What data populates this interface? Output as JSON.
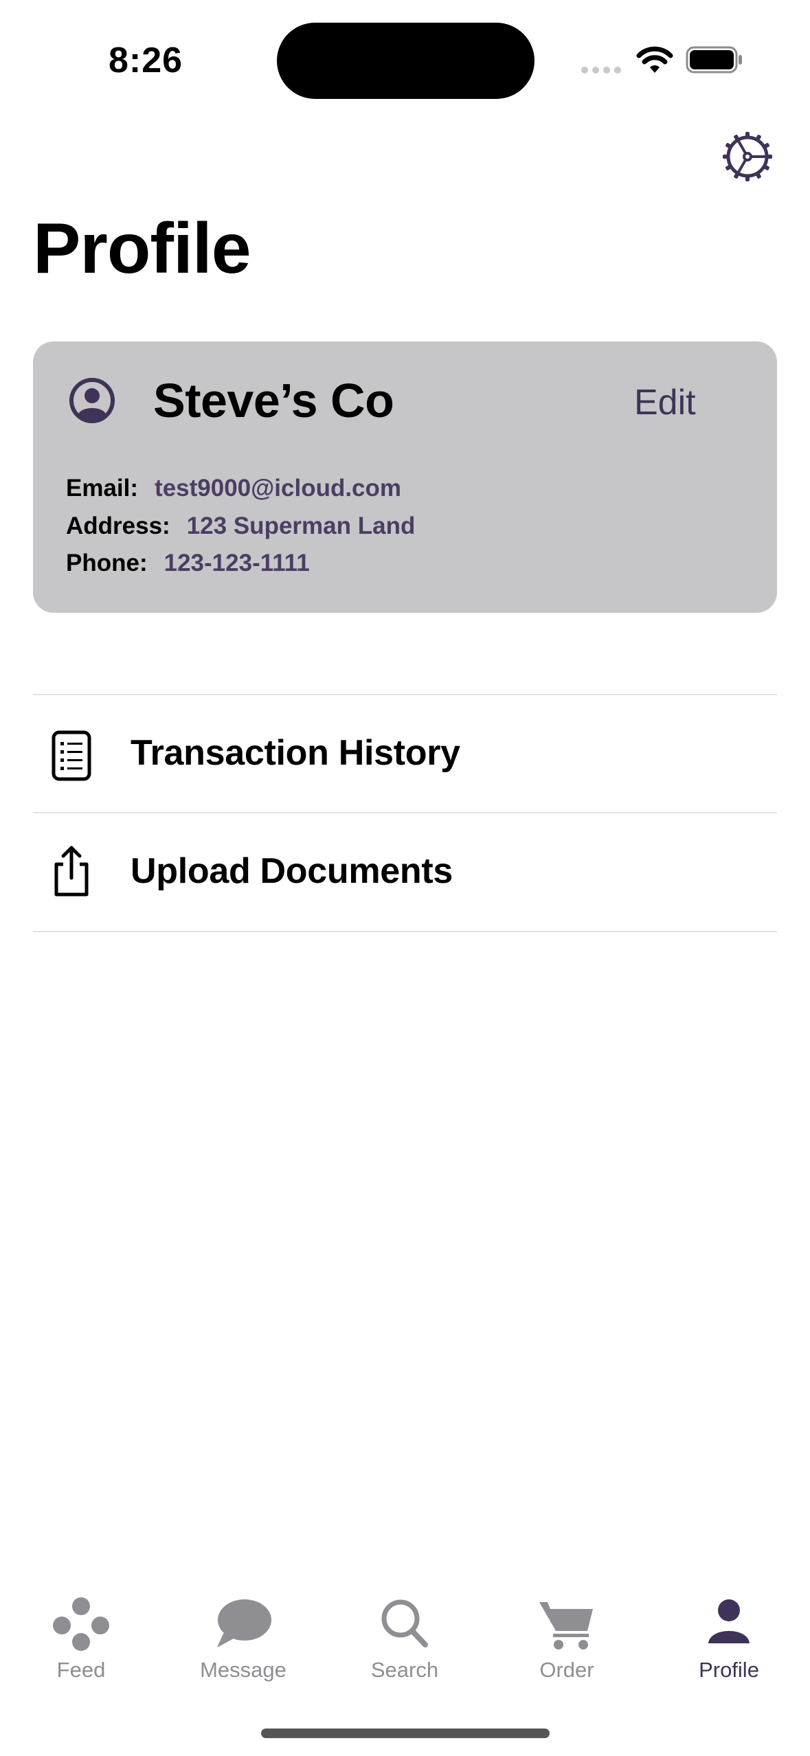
{
  "status_bar": {
    "time": "8:26"
  },
  "header": {
    "title": "Profile",
    "settings_icon": "gear-icon"
  },
  "profile_card": {
    "name": "Steve’s Co",
    "edit_label": "Edit",
    "email_label": "Email:",
    "email": "test9000@icloud.com",
    "address_label": "Address:",
    "address": "123 Superman Land",
    "phone_label": "Phone:",
    "phone": "123-123-1111"
  },
  "menu": {
    "items": [
      {
        "label": "Transaction History",
        "icon": "receipt-icon"
      },
      {
        "label": "Upload Documents",
        "icon": "share-upload-icon"
      }
    ]
  },
  "tab_bar": {
    "tabs": [
      {
        "label": "Feed",
        "icon": "feed-icon"
      },
      {
        "label": "Message",
        "icon": "message-bubble-icon"
      },
      {
        "label": "Search",
        "icon": "magnifier-icon"
      },
      {
        "label": "Order",
        "icon": "cart-icon"
      },
      {
        "label": "Profile",
        "icon": "person-icon"
      }
    ],
    "active": "Profile"
  },
  "colors": {
    "accent": "#3f3357",
    "card_background": "#c6c6c8",
    "inactive_tab": "#8e8e93"
  }
}
